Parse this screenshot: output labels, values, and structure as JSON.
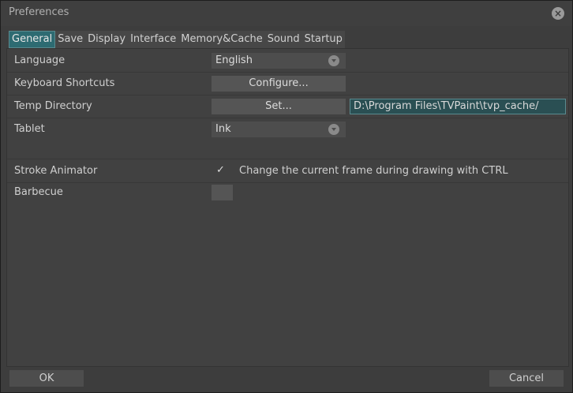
{
  "window": {
    "title": "Preferences"
  },
  "tabs": [
    {
      "label": "General",
      "active": true
    },
    {
      "label": "Save"
    },
    {
      "label": "Display"
    },
    {
      "label": "Interface"
    },
    {
      "label": "Memory&Cache"
    },
    {
      "label": "Sound"
    },
    {
      "label": "Startup"
    }
  ],
  "general": {
    "language": {
      "label": "Language",
      "value": "English"
    },
    "keyboard_shortcuts": {
      "label": "Keyboard Shortcuts",
      "button": "Configure..."
    },
    "temp_directory": {
      "label": "Temp Directory",
      "button": "Set...",
      "path": "D:\\Program Files\\TVPaint\\tvp_cache/"
    },
    "tablet": {
      "label": "Tablet",
      "value": "Ink"
    },
    "stroke_animator": {
      "label": "Stroke Animator",
      "checkmark": "✓",
      "option_text": "Change the current frame during drawing with CTRL",
      "checked": true
    },
    "barbecue": {
      "label": "Barbecue"
    }
  },
  "footer": {
    "ok": "OK",
    "cancel": "Cancel"
  },
  "colors": {
    "accent": "#2d6b72",
    "background": "#3d3d3d",
    "panel": "#414141"
  }
}
